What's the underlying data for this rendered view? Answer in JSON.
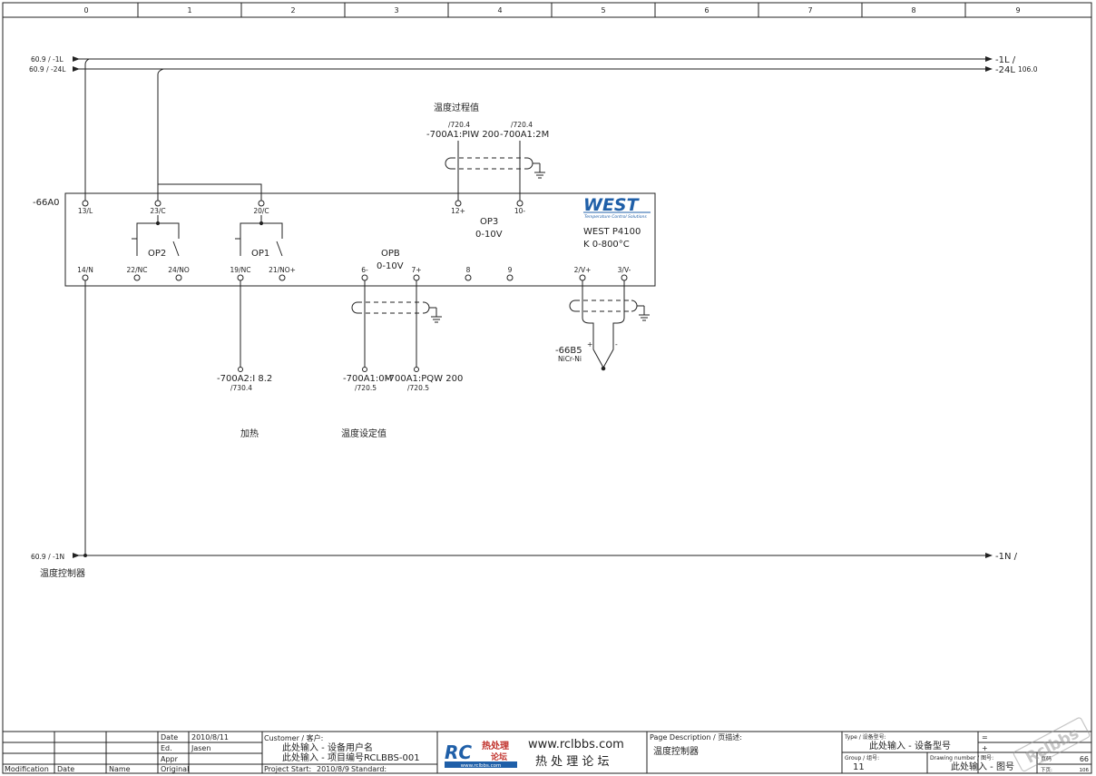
{
  "columns": [
    "0",
    "1",
    "2",
    "3",
    "4",
    "5",
    "6",
    "7",
    "8",
    "9"
  ],
  "rails": {
    "L1_ref": "60.9 / -1L",
    "L24_ref": "60.9 / -24L",
    "L1_out": "-1L /",
    "L24_out": "-24L",
    "L24_page": "106.0",
    "N_ref": "60.9 / -1N",
    "N_out": "-1N /"
  },
  "device": {
    "tag": "-66A0",
    "brand": "WEST",
    "brand_tagline": "Temperature Control Solutions",
    "model": "WEST P4100",
    "range": "K 0-800°C",
    "op1_label": "OP1",
    "op2_label": "OP2",
    "op3_label": "OP3",
    "op3_range": "0-10V",
    "opb_label": "OPB",
    "opb_range": "0-10V",
    "terminals_top": [
      "13/L",
      "23/C",
      "20/C",
      "12+",
      "10-"
    ],
    "terminals_bottom": [
      "14/N",
      "22/NC",
      "24/NO",
      "19/NC",
      "21/NO+",
      "6-",
      "7+",
      "8",
      "9",
      "2/V+",
      "3/V-"
    ]
  },
  "labels": {
    "pv_title": "温度过程值",
    "pv_ref1": "/720.4",
    "pv_tag1": "-700A1:PIW 200",
    "pv_ref2": "/720.4",
    "pv_tag2": "-700A1:2M",
    "heat_tag": "-700A2:I 8.2",
    "heat_ref": "/730.4",
    "heat_title": "加热",
    "sp_tag1": "-700A1:0M",
    "sp_ref1": "/720.5",
    "sp_tag2": "-700A1:PQW 200",
    "sp_ref2": "/720.5",
    "sp_title": "温度设定值",
    "tc_tag": "-66B5",
    "tc_type": "NiCr-Ni",
    "tc_plus": "+",
    "tc_minus": "-",
    "sheet_title": "温度控制器"
  },
  "title_block": {
    "modification": "Modification",
    "date_h": "Date",
    "name_h": "Name",
    "original_h": "Original",
    "date_label": "Date",
    "date_value": "2010/8/11",
    "ed_label": "Ed.",
    "ed_value": "Jasen",
    "appr_label": "Appr",
    "customer_label": "Customer / 客户:",
    "customer_line1": "此处输入 - 设备用户名",
    "customer_line2": "此处输入 - 项目编号RCLBBS-001",
    "project_start_label": "Project Start:",
    "project_start_value": "2010/8/9",
    "standard_label": "Standard:",
    "logo_letters": "RC",
    "logo_cn1": "热处理",
    "logo_cn2": "论坛",
    "logo_url_small": "www.rclbbs.com",
    "site_url": "www.rclbbs.com",
    "site_cn": "热 处 理 论 坛",
    "page_desc_label": "Page Description / 页描述:",
    "page_desc_value": "温度控制器",
    "type_label": "Type / 设备型号:",
    "type_value": "此处输入 - 设备型号",
    "group_label": "Group / 组号:",
    "group_value": "11",
    "drawing_label": "Drawing number / 图号:",
    "drawing_value": "此处输入 - 图号",
    "eq": "=",
    "plus": "+",
    "page_label": "页码",
    "page_value": "66",
    "next_label": "下页:",
    "next_value": "106",
    "watermark": "Rclbbs"
  },
  "colors": {
    "line": "#222222",
    "brand": "#1f5fa8",
    "logo_red": "#c0302a"
  }
}
